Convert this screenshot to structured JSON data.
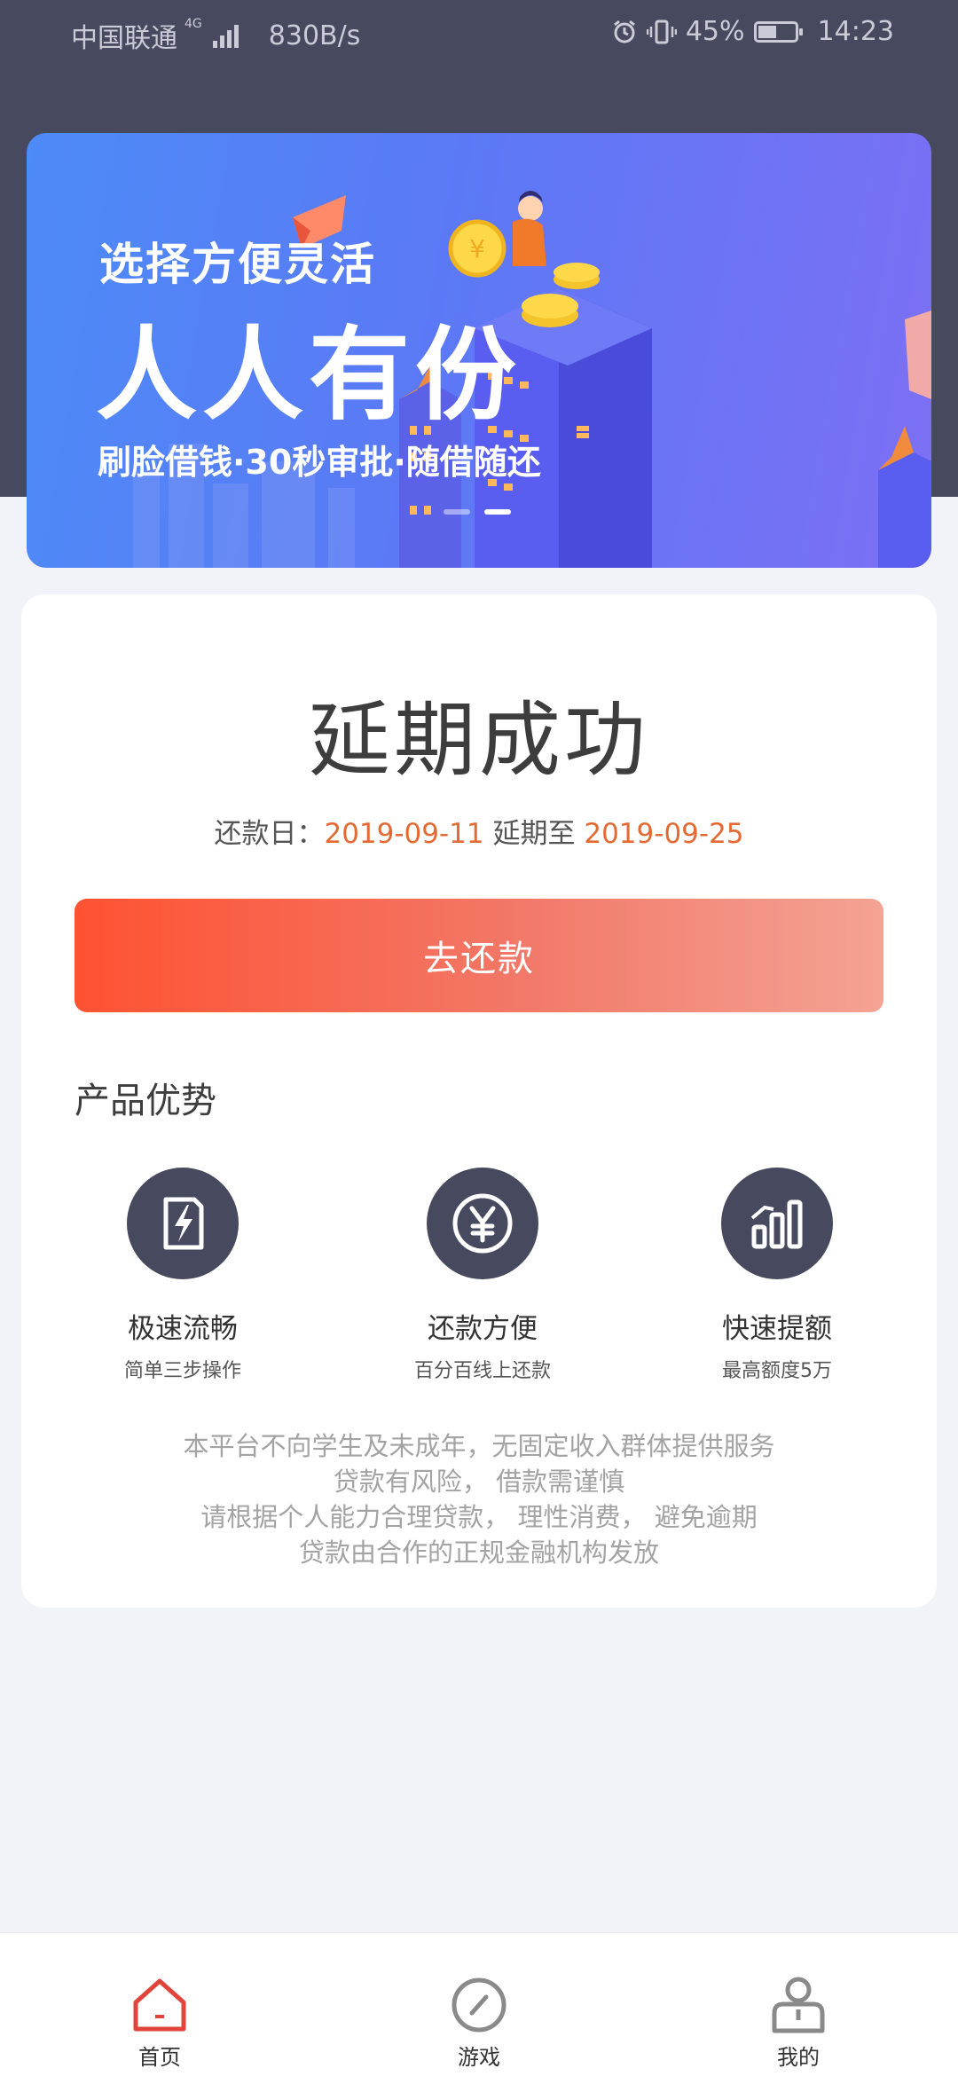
{
  "status_bar": {
    "carrier": "中国联通",
    "network": "4G",
    "speed": "830B/s",
    "battery": "45%",
    "time": "14:23"
  },
  "banner": {
    "subtitle": "选择方便灵活",
    "title": "人人有份",
    "tagline": "刷脸借钱·30秒审批·随借随还",
    "slide_count": 2,
    "active_slide": 2
  },
  "result": {
    "title": "延期成功",
    "due_label": "还款日：",
    "due_date": "2019-09-11",
    "extend_label": "延期至",
    "extend_date": "2019-09-25"
  },
  "repay_button": {
    "label": "去还款"
  },
  "advantages": {
    "title": "产品优势",
    "items": [
      {
        "name": "极速流畅",
        "desc": "简单三步操作",
        "icon": "lightning-doc-icon"
      },
      {
        "name": "还款方便",
        "desc": "百分百线上还款",
        "icon": "yen-coin-icon"
      },
      {
        "name": "快速提额",
        "desc": "最高额度5万",
        "icon": "bar-chart-icon"
      }
    ]
  },
  "notice": {
    "lines": [
      "本平台不向学生及未成年，无固定收入群体提供服务",
      "贷款有风险， 借款需谨慎",
      "请根据个人能力合理贷款， 理性消费， 避免逾期",
      "贷款由合作的正规金融机构发放"
    ]
  },
  "tabbar": {
    "items": [
      {
        "label": "首页",
        "icon": "home-icon",
        "active": true
      },
      {
        "label": "游戏",
        "icon": "compass-icon",
        "active": false
      },
      {
        "label": "我的",
        "icon": "user-icon",
        "active": false
      }
    ]
  },
  "colors": {
    "dark": "#474a5f",
    "accent": "#e46a34",
    "button_start": "#ff5232",
    "button_end": "#f4a394",
    "tab_active": "#e0443a"
  }
}
